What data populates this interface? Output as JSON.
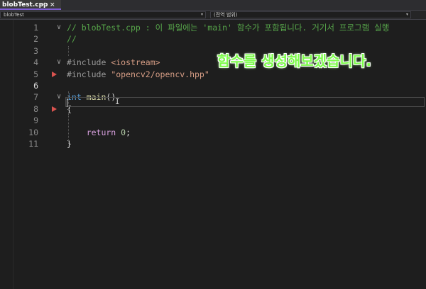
{
  "tab": {
    "title": "blobTest.cpp",
    "pin_icon": "pin-icon",
    "close_icon": "close-icon",
    "pin_glyph": "⊣",
    "close_glyph": "×"
  },
  "navbar": {
    "left": "blobTest",
    "right": "(전역 범위)",
    "arrow": "▾"
  },
  "editor": {
    "lines": [
      {
        "n": "1",
        "tokens": [
          {
            "t": "// blobTest.cpp : 이 파일에는 'main' 함수가 포함됩니다. 거기서 프로그램 실행",
            "c": "c-comment"
          }
        ],
        "fold": "∨"
      },
      {
        "n": "2",
        "tokens": [
          {
            "t": "//",
            "c": "c-comment"
          }
        ],
        "fold": ""
      },
      {
        "n": "3",
        "tokens": [],
        "fold": ""
      },
      {
        "n": "4",
        "tokens": [
          {
            "t": "#include ",
            "c": "c-pre"
          },
          {
            "t": "<iostream>",
            "c": "c-str"
          }
        ],
        "fold": "∨"
      },
      {
        "n": "5",
        "tokens": [
          {
            "t": "#include ",
            "c": "c-pre"
          },
          {
            "t": "\"opencv2/opencv.hpp\"",
            "c": "c-str"
          }
        ],
        "fold": ""
      },
      {
        "n": "6",
        "tokens": [],
        "fold": ""
      },
      {
        "n": "7",
        "tokens": [
          {
            "t": "int ",
            "c": "c-kw"
          },
          {
            "t": "main",
            "c": "c-fn"
          },
          {
            "t": "()",
            "c": "c-txt"
          }
        ],
        "fold": "∨"
      },
      {
        "n": "8",
        "tokens": [
          {
            "t": "{",
            "c": "c-txt"
          }
        ],
        "fold": ""
      },
      {
        "n": "9",
        "tokens": [],
        "fold": ""
      },
      {
        "n": "10",
        "tokens": [
          {
            "t": "    return ",
            "c": "c-ctrl"
          },
          {
            "t": "0",
            "c": "c-num"
          },
          {
            "t": ";",
            "c": "c-txt"
          }
        ],
        "fold": ""
      },
      {
        "n": "11",
        "tokens": [
          {
            "t": "}",
            "c": "c-txt"
          }
        ],
        "fold": ""
      }
    ],
    "current_line": "6",
    "breakpoint_lines": [
      "5",
      "8"
    ]
  },
  "overlay": {
    "caption": "함수를 생성해보겠습니다."
  },
  "colors": {
    "accent": "#7f5dd6",
    "breakpoint": "#d9534f",
    "caption": "#7cfc4a"
  }
}
